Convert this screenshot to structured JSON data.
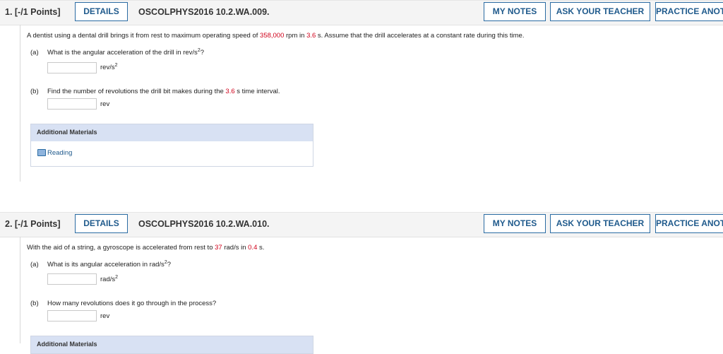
{
  "questions": [
    {
      "number_label": "1. [-/1 Points]",
      "details_label": "DETAILS",
      "code": "OSCOLPHYS2016 10.2.WA.009.",
      "my_notes_label": "MY NOTES",
      "ask_teacher_label": "ASK YOUR TEACHER",
      "practice_label": "PRACTICE ANOTHER",
      "prompt": {
        "t1": "A dentist using a dental drill brings it from rest to maximum operating speed of ",
        "v1": "358,000",
        "t2": " rpm in ",
        "v2": "3.6",
        "t3": " s. Assume that the drill accelerates at a constant rate during this time."
      },
      "part_a": {
        "label": "(a)",
        "text": "What is the angular acceleration of the drill in rev/s",
        "text_sup": "2",
        "text_end": "?",
        "answer_value": "",
        "unit": "rev/s",
        "unit_sup": "2"
      },
      "part_b": {
        "label": "(b)",
        "text1": "Find the number of revolutions the drill bit makes during the ",
        "value": "3.6",
        "text2": " s time interval.",
        "answer_value": "",
        "unit": "rev"
      },
      "additional_materials": {
        "header": "Additional Materials",
        "reading_label": "Reading",
        "reading_icon": "book-icon"
      }
    },
    {
      "number_label": "2. [-/1 Points]",
      "details_label": "DETAILS",
      "code": "OSCOLPHYS2016 10.2.WA.010.",
      "my_notes_label": "MY NOTES",
      "ask_teacher_label": "ASK YOUR TEACHER",
      "practice_label": "PRACTICE ANOTHER",
      "prompt": {
        "t1": "With the aid of a string, a gyroscope is accelerated from rest to ",
        "v1": "37",
        "t2": " rad/s in ",
        "v2": "0.4",
        "t3": " s."
      },
      "part_a": {
        "label": "(a)",
        "text": "What is its angular acceleration in rad/s",
        "text_sup": "2",
        "text_end": "?",
        "answer_value": "",
        "unit": "rad/s",
        "unit_sup": "2"
      },
      "part_b": {
        "label": "(b)",
        "text": "How many revolutions does it go through in the process?",
        "answer_value": "",
        "unit": "rev"
      },
      "additional_materials": {
        "header": "Additional Materials"
      }
    }
  ],
  "colors": {
    "highlight_value": "#d0021b",
    "button_border": "#2b6ca3",
    "button_text": "#1f5a8c",
    "header_bg": "#f4f4f4",
    "addl_header_bg": "#d8e1f3"
  }
}
